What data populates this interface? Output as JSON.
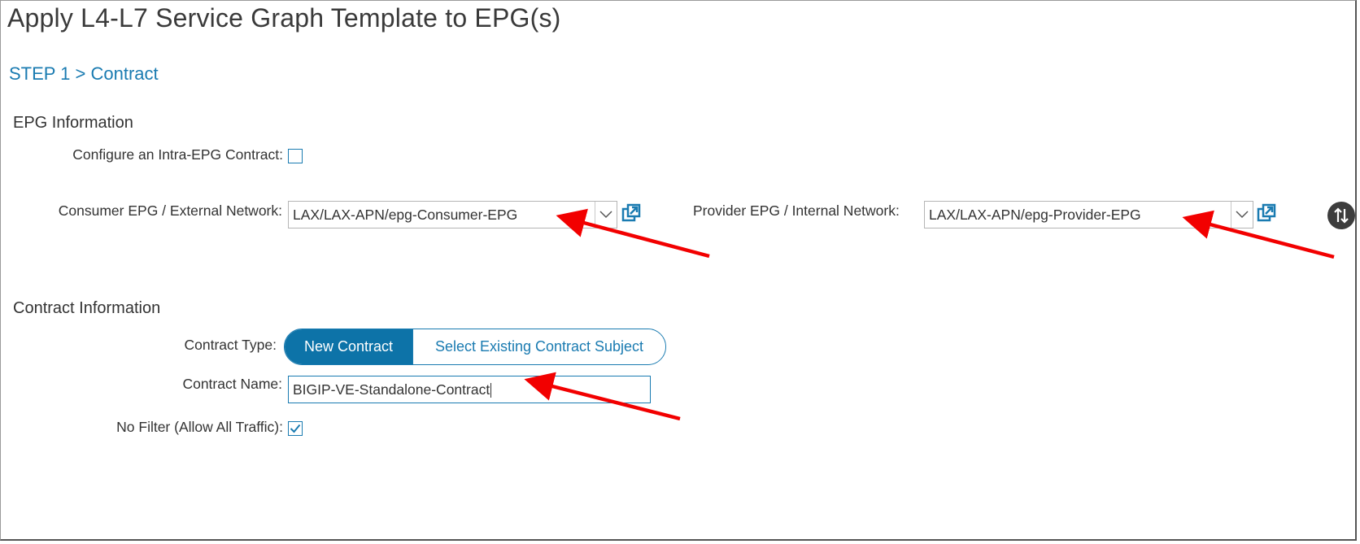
{
  "dialog": {
    "title": "Apply L4-L7 Service Graph Template to EPG(s)",
    "step": "STEP 1 > Contract"
  },
  "epg_info": {
    "heading": "EPG Information",
    "intra_epg_label": "Configure an Intra-EPG Contract:",
    "intra_epg_checked": false,
    "consumer_label": "Consumer EPG / External Network:",
    "consumer_value": "LAX/LAX-APN/epg-Consumer-EPG",
    "provider_label": "Provider EPG / Internal Network:",
    "provider_value": "LAX/LAX-APN/epg-Provider-EPG"
  },
  "contract_info": {
    "heading": "Contract Information",
    "type_label": "Contract Type:",
    "type_options": [
      "New Contract",
      "Select Existing Contract Subject"
    ],
    "type_selected": "New Contract",
    "name_label": "Contract Name:",
    "name_value": "BIGIP-VE-Standalone-Contract",
    "no_filter_label": "No Filter (Allow All Traffic):",
    "no_filter_checked": true
  },
  "icons": {
    "dropdown": "chevron-down-icon",
    "open_external": "open-external-icon",
    "side_action": "swap-icon",
    "annotation": "red-arrow"
  },
  "colors": {
    "accent": "#1a7bb1",
    "toggle_active": "#0d73a8",
    "annotation_arrow": "#f20000"
  }
}
